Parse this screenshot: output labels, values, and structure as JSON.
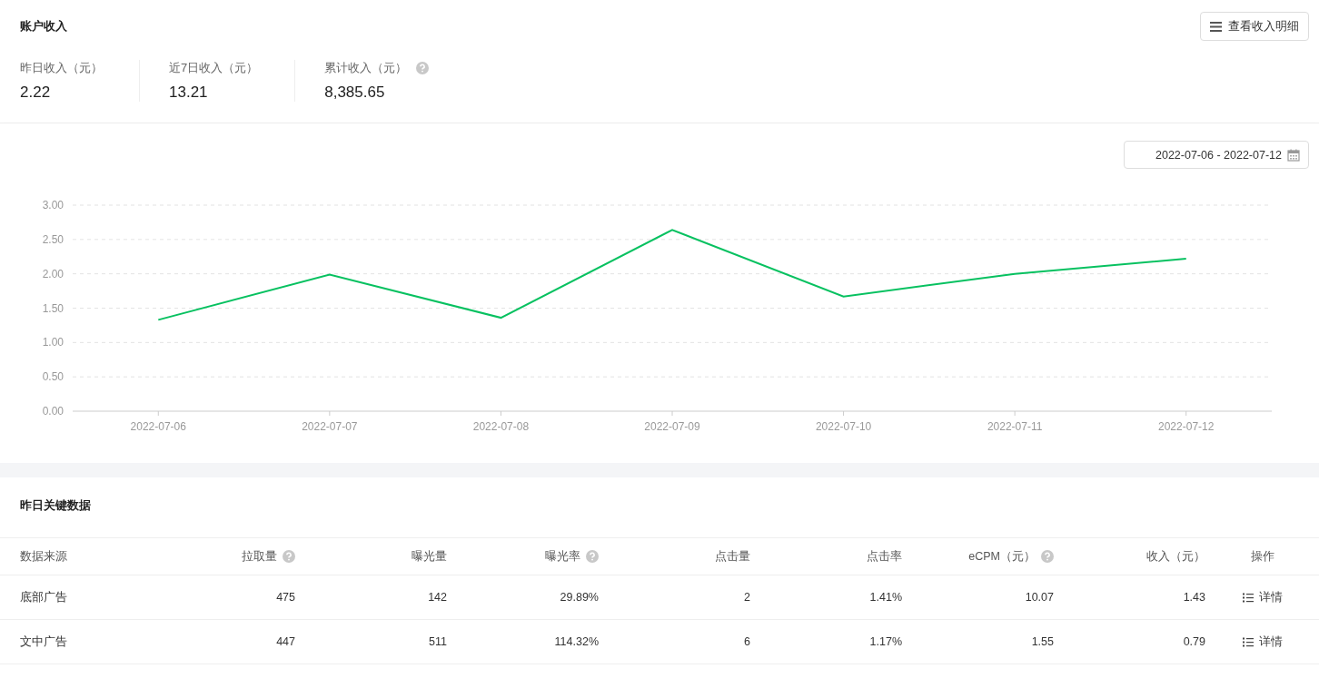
{
  "account": {
    "title": "账户收入",
    "detail_button": "查看收入明细",
    "stats": [
      {
        "label": "昨日收入（元）",
        "value": "2.22",
        "help": false
      },
      {
        "label": "近7日收入（元）",
        "value": "13.21",
        "help": false
      },
      {
        "label": "累计收入（元）",
        "value": "8,385.65",
        "help": true
      }
    ]
  },
  "date_range": "2022-07-06 - 2022-07-12",
  "chart_data": {
    "type": "line",
    "categories": [
      "2022-07-06",
      "2022-07-07",
      "2022-07-08",
      "2022-07-09",
      "2022-07-10",
      "2022-07-11",
      "2022-07-12"
    ],
    "yticks": [
      {
        "value": 0,
        "label": "0.00"
      },
      {
        "value": 0.5,
        "label": "0.50"
      },
      {
        "value": 1,
        "label": "1.00"
      },
      {
        "value": 1.5,
        "label": "1.50"
      },
      {
        "value": 2,
        "label": "2.00"
      },
      {
        "value": 2.5,
        "label": "2.50"
      },
      {
        "value": 3,
        "label": "3.00"
      }
    ],
    "ylim": [
      0,
      3
    ],
    "grid": true,
    "series": [
      {
        "color": "#07c160",
        "values": [
          1.33,
          1.99,
          1.36,
          2.64,
          1.67,
          2.0,
          2.22
        ]
      }
    ]
  },
  "key_data": {
    "title": "昨日关键数据",
    "columns": [
      {
        "label": "数据来源",
        "help": false
      },
      {
        "label": "拉取量",
        "help": true
      },
      {
        "label": "曝光量",
        "help": false
      },
      {
        "label": "曝光率",
        "help": true
      },
      {
        "label": "点击量",
        "help": false
      },
      {
        "label": "点击率",
        "help": false
      },
      {
        "label": "eCPM（元）",
        "help": true
      },
      {
        "label": "收入（元）",
        "help": false
      },
      {
        "label": "操作",
        "help": false
      }
    ],
    "rows": [
      {
        "cells": [
          "底部广告",
          "475",
          "142",
          "29.89%",
          "2",
          "1.41%",
          "10.07",
          "1.43"
        ],
        "action": "详情"
      },
      {
        "cells": [
          "文中广告",
          "447",
          "511",
          "114.32%",
          "6",
          "1.17%",
          "1.55",
          "0.79"
        ],
        "action": "详情"
      }
    ]
  }
}
